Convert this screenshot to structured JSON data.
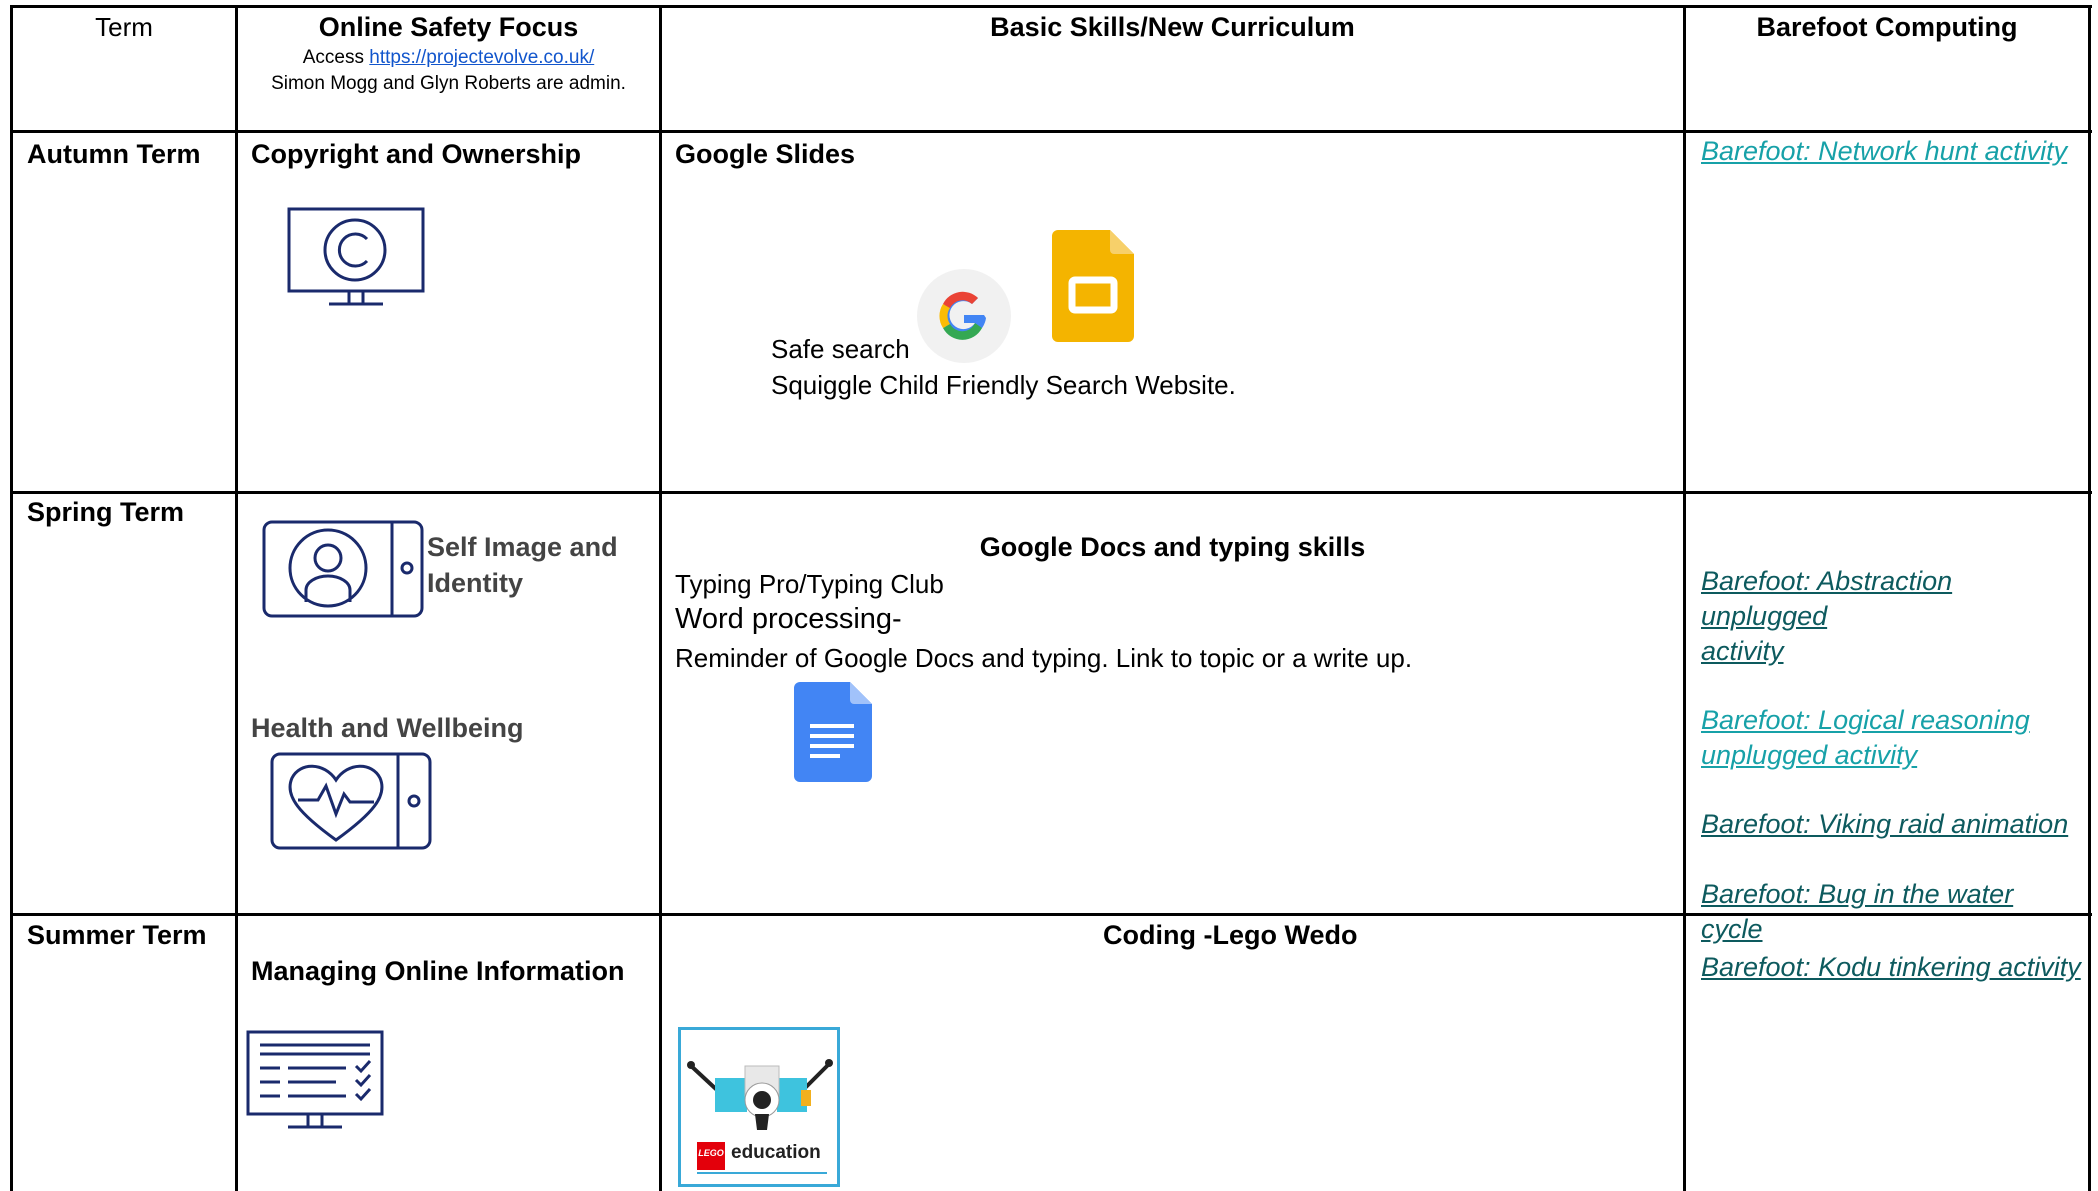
{
  "header": {
    "term": "Term",
    "online_safety": "Online Safety Focus",
    "access_prefix": "Access ",
    "access_link": "https://projectevolve.co.uk/",
    "admin_note": "Simon Mogg and Glyn Roberts are admin.",
    "basic_skills": "Basic Skills/New Curriculum",
    "barefoot": "Barefoot Computing"
  },
  "rows": {
    "autumn": {
      "term": "Autumn Term",
      "safety_topic": "Copyright and Ownership",
      "skills_title": "Google Slides",
      "skills_line1": "Safe search",
      "skills_line2": "Squiggle Child Friendly Search Website.",
      "barefoot_links": [
        "Barefoot: Network hunt activity"
      ]
    },
    "spring": {
      "term": "Spring Term",
      "safety_topic1_line1": "Self Image and",
      "safety_topic1_line2": "Identity",
      "safety_topic2": "Health and Wellbeing",
      "skills_title": "Google Docs and typing skills",
      "skills_line1": "Typing Pro/Typing Club",
      "skills_line2": "Word processing-",
      "skills_line3": "Reminder of Google Docs and typing. Link to topic or a write up.",
      "barefoot_links": [
        "Barefoot: Abstraction unplugged",
        "activity",
        "Barefoot: Logical reasoning",
        "unplugged activity",
        "Barefoot: Viking raid animation",
        "Barefoot: Bug in the water cycle"
      ]
    },
    "summer": {
      "term": "Summer Term",
      "safety_topic": "Managing Online Information",
      "skills_title": "Coding -Lego Wedo",
      "lego_word": "LEGO",
      "lego_caption": "education",
      "barefoot_links": [
        "Barefoot: Kodu tinkering activity"
      ]
    }
  },
  "colors": {
    "icon_navy": "#1a2a6c",
    "link_teal": "#17a1a8",
    "link_dark_teal": "#0d5a5e",
    "link_blue": "#1155cc",
    "slides_yellow": "#f4b400",
    "docs_blue": "#4285f4"
  },
  "icons": [
    "copyright-monitor-icon",
    "google-g-icon",
    "google-slides-icon",
    "selfie-phone-icon",
    "heart-phone-icon",
    "google-docs-icon",
    "checklist-monitor-icon",
    "lego-wedo-logo"
  ]
}
